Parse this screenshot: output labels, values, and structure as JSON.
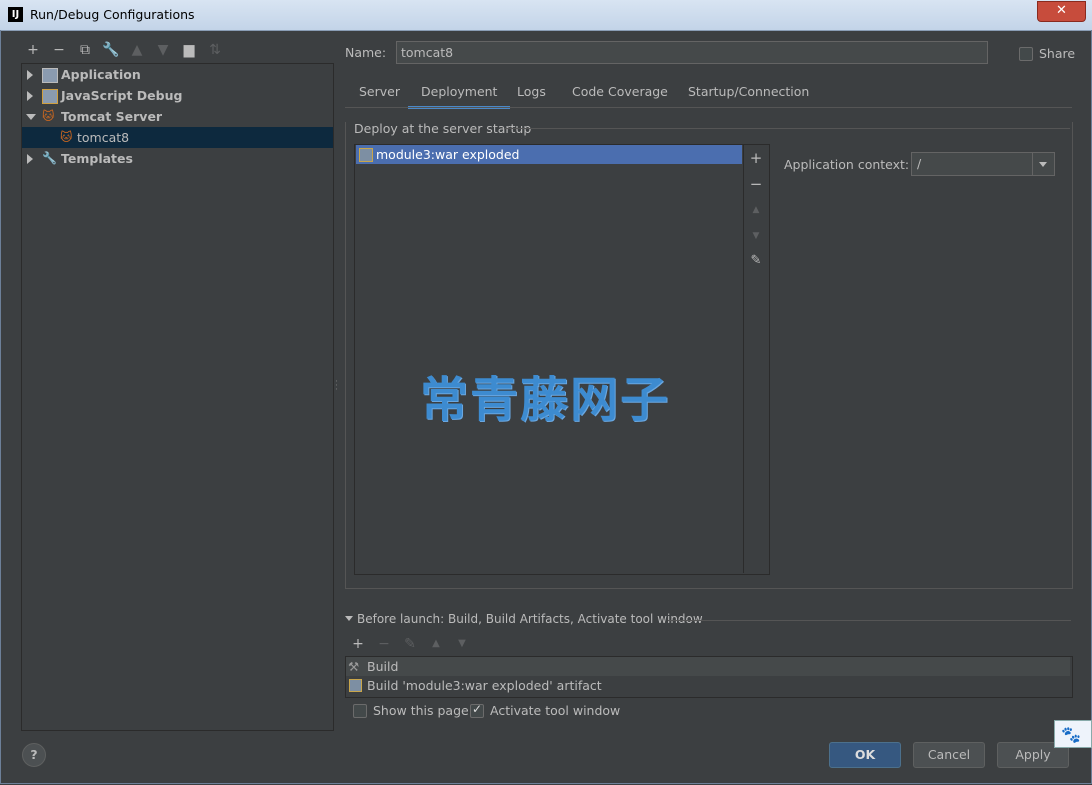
{
  "window": {
    "title": "Run/Debug Configurations",
    "app_icon_text": "IJ"
  },
  "toolbar": {
    "icons": [
      "plus-icon",
      "minus-icon",
      "copy-icon",
      "wrench-icon",
      "arrow-up-icon",
      "arrow-down-icon",
      "folder-add-icon",
      "sort-icon"
    ]
  },
  "tree": {
    "items": [
      {
        "label": "Application",
        "icon": "application-icon"
      },
      {
        "label": "JavaScript Debug",
        "icon": "javascript-debug-icon"
      },
      {
        "label": "Tomcat Server",
        "icon": "tomcat-icon"
      },
      {
        "label": "tomcat8",
        "icon": "tomcat-icon"
      },
      {
        "label": "Templates",
        "icon": "wrench-icon"
      }
    ]
  },
  "name_field": {
    "label": "Name:",
    "value": "tomcat8"
  },
  "share": {
    "label": "Share",
    "checked": false
  },
  "tabs": [
    "Server",
    "Deployment",
    "Logs",
    "Code Coverage",
    "Startup/Connection"
  ],
  "active_tab": "Deployment",
  "deploy": {
    "group_title": "Deploy at the server startup",
    "artifacts": [
      "module3:war exploded"
    ],
    "context_label": "Application context:",
    "context_value": "/"
  },
  "watermark": "常青藤网子",
  "before_launch": {
    "title": "Before launch: Build, Build Artifacts, Activate tool window",
    "tasks": [
      "Build",
      "Build 'module3:war exploded' artifact"
    ]
  },
  "options": {
    "show_page": {
      "label": "Show this page",
      "checked": false
    },
    "activate_tool_window": {
      "label": "Activate tool window",
      "checked": true
    }
  },
  "buttons": {
    "ok": "OK",
    "cancel": "Cancel",
    "apply": "Apply",
    "help": "?"
  },
  "colors": {
    "background": "#3c3f41",
    "selection": "#4b6eaf",
    "tree_selection": "#0d293e",
    "accent": "#4a88c7",
    "ok_button": "#365880"
  }
}
